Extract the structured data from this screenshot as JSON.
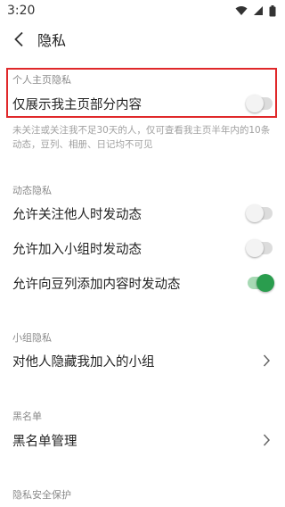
{
  "status_bar": {
    "time": "3:20"
  },
  "nav": {
    "title": "隐私"
  },
  "profile_privacy": {
    "section_label": "个人主页隐私",
    "row_label": "仅展示我主页部分内容",
    "toggle_on": false,
    "note": "未关注或关注我不足30天的人，仅可查看我主页半年内的10条动态，豆列、相册、日记均不可见"
  },
  "activity_privacy": {
    "section_label": "动态隐私",
    "rows": [
      {
        "label": "允许关注他人时发动态",
        "on": false
      },
      {
        "label": "允许加入小组时发动态",
        "on": false
      },
      {
        "label": "允许向豆列添加内容时发动态",
        "on": true
      }
    ]
  },
  "group_privacy": {
    "section_label": "小组隐私",
    "row_label": "对他人隐藏我加入的小组"
  },
  "blacklist": {
    "section_label": "黑名单",
    "row_label": "黑名单管理"
  },
  "security": {
    "section_label": "隐私安全保护"
  },
  "colors": {
    "accent": "#2a9d4e",
    "highlight": "#e0282a"
  },
  "icons": {
    "back": "chevron-left-icon",
    "arrow": "chevron-right-icon"
  }
}
